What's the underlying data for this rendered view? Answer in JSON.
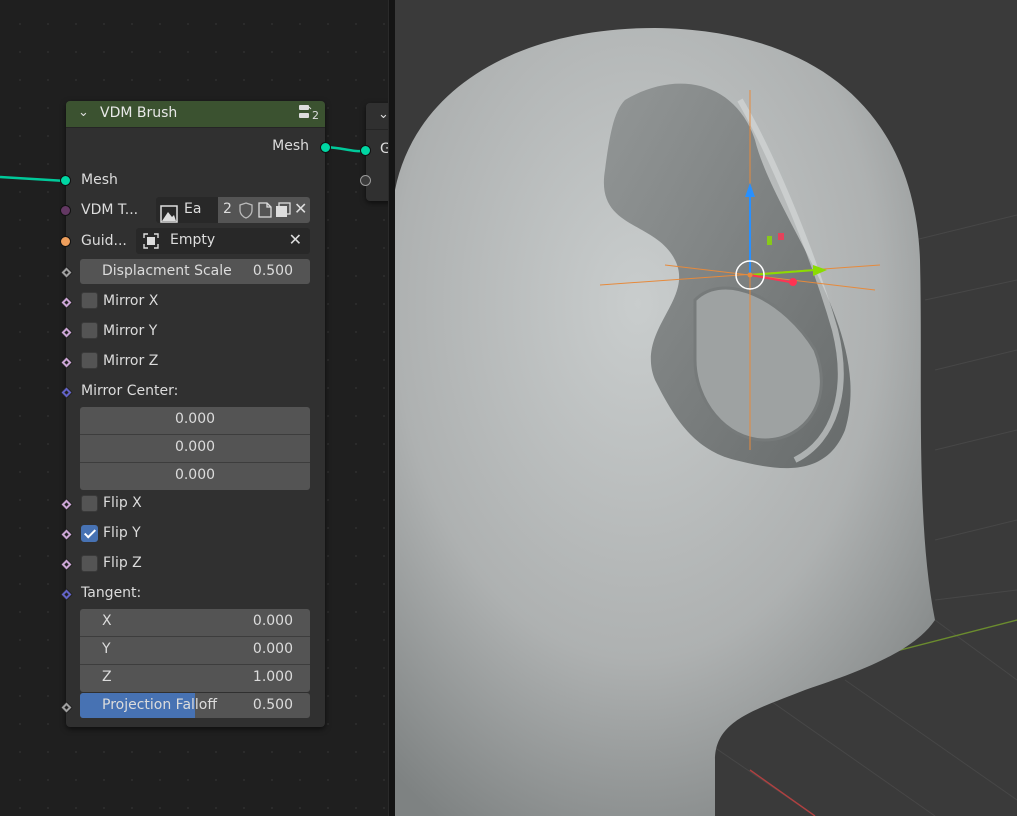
{
  "node": {
    "title": "VDM Brush",
    "user_count": "2",
    "output_mesh": "Mesh",
    "input_mesh": "Mesh",
    "texture_label": "VDM T...",
    "texture_name": "Ea",
    "texture_users": "2",
    "guide_label": "Guid...",
    "guide_value": "Empty",
    "displacement_label": "Displacment Scale",
    "displacement_value": "0.500",
    "mirror_x": "Mirror X",
    "mirror_y": "Mirror Y",
    "mirror_z": "Mirror Z",
    "mirror_center_label": "Mirror Center:",
    "mirror_center": [
      "0.000",
      "0.000",
      "0.000"
    ],
    "flip_x": "Flip X",
    "flip_y": "Flip Y",
    "flip_z": "Flip Z",
    "flip_y_checked": true,
    "tangent_label": "Tangent:",
    "tangent": [
      {
        "axis": "X",
        "value": "0.000"
      },
      {
        "axis": "Y",
        "value": "0.000"
      },
      {
        "axis": "Z",
        "value": "1.000"
      }
    ],
    "falloff_label": "Projection Falloff",
    "falloff_value": "0.500",
    "falloff_fraction": 0.5
  },
  "next_node": {
    "input_label": "G"
  },
  "colors": {
    "node_header": "#3b5230",
    "geometry_socket": "#00d6a3",
    "image_socket": "#633863",
    "object_socket": "#ed9e5c",
    "float_socket": "#a1a1a1",
    "bool_socket": "#cca6d6",
    "vector_socket": "#6363c7",
    "slider_fill": "#4772b3",
    "gizmo_x": "#ff3352",
    "gizmo_y": "#8bdc00",
    "gizmo_z": "#2890ff"
  }
}
